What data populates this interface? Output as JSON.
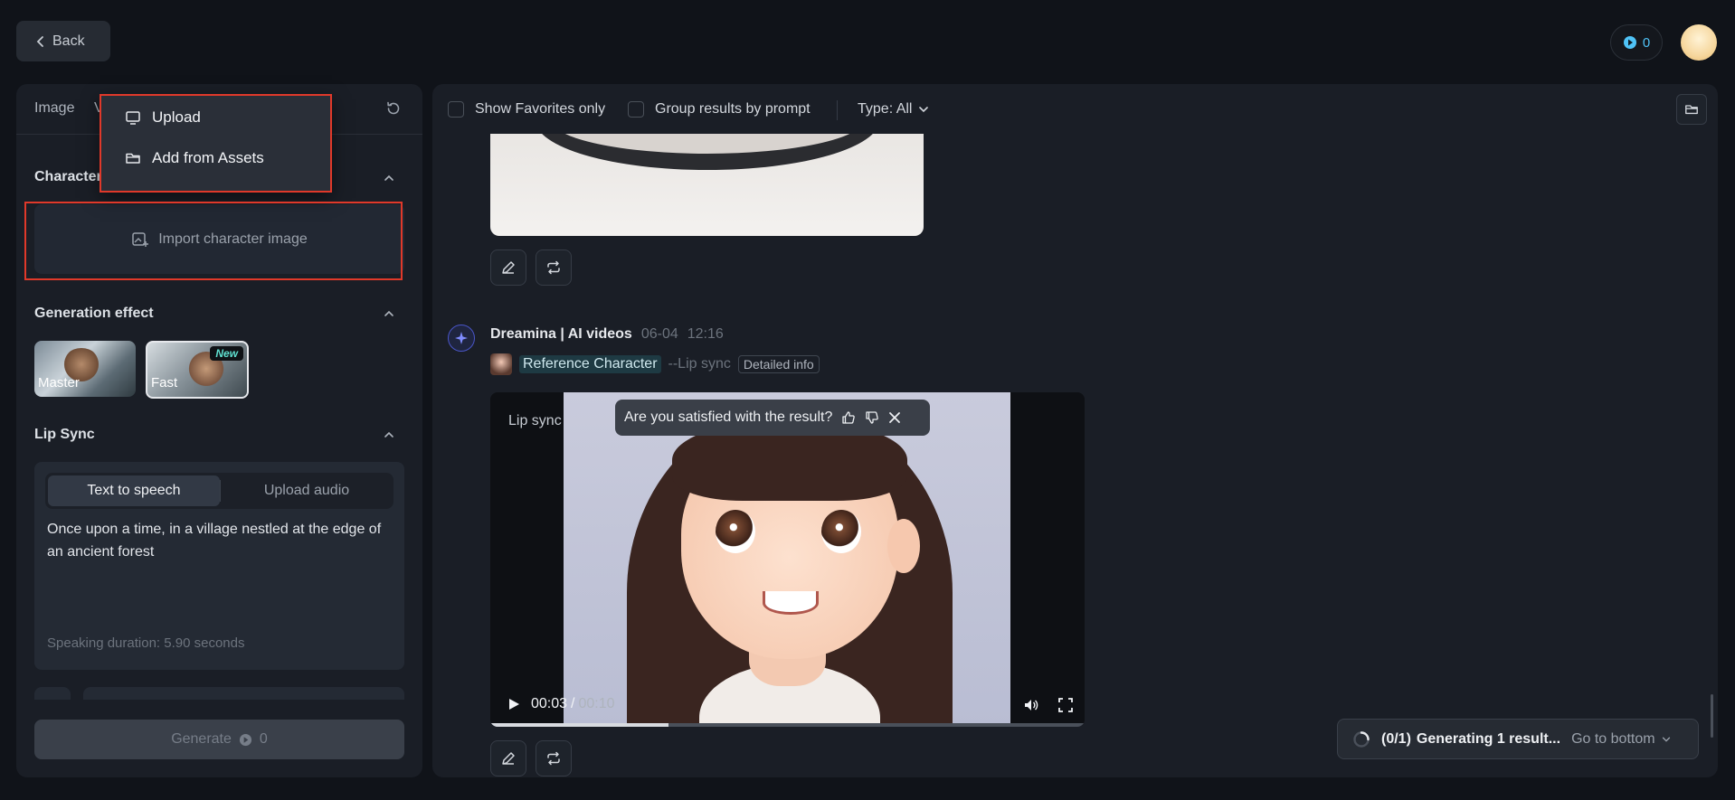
{
  "header": {
    "back_label": "Back",
    "credits": "0"
  },
  "left": {
    "tabs": [
      "Image",
      "Vi"
    ],
    "dropdown": {
      "upload_label": "Upload",
      "assets_label": "Add from Assets"
    },
    "character_title": "Character",
    "import_label": "Import character image",
    "generation_effect_title": "Generation effect",
    "effects": [
      {
        "label": "Master"
      },
      {
        "label": "Fast",
        "badge": "New"
      }
    ],
    "lip_sync_title": "Lip Sync",
    "lip_tabs": {
      "tts": "Text to speech",
      "upload": "Upload audio"
    },
    "script_text": "Once upon a time, in a village nestled at the edge of an ancient forest",
    "speaking_duration": "Speaking duration: 5.90 seconds",
    "generate_label": "Generate",
    "generate_cost": "0"
  },
  "toolbar": {
    "favorites_label": "Show Favorites only",
    "group_label": "Group results by prompt",
    "type_label": "Type: All"
  },
  "result": {
    "author": "Dreamina | AI videos",
    "date": "06-04",
    "time": "12:16",
    "ref_label": "Reference Character",
    "mode": "--Lip sync",
    "detail_label": "Detailed info",
    "video_overlay_label": "Lip sync",
    "feedback_question": "Are you satisfied with the result?",
    "current_time": "00:03",
    "separator": "/",
    "duration": "00:10",
    "progress": 0.3
  },
  "status": {
    "count": "(0/1)",
    "message": "Generating 1 result...",
    "goto": "Go to bottom"
  },
  "colors": {
    "accent": "#4fc3f7",
    "highlight_box": "#e0392a",
    "panel": "#1a1e26",
    "background": "#101319"
  }
}
